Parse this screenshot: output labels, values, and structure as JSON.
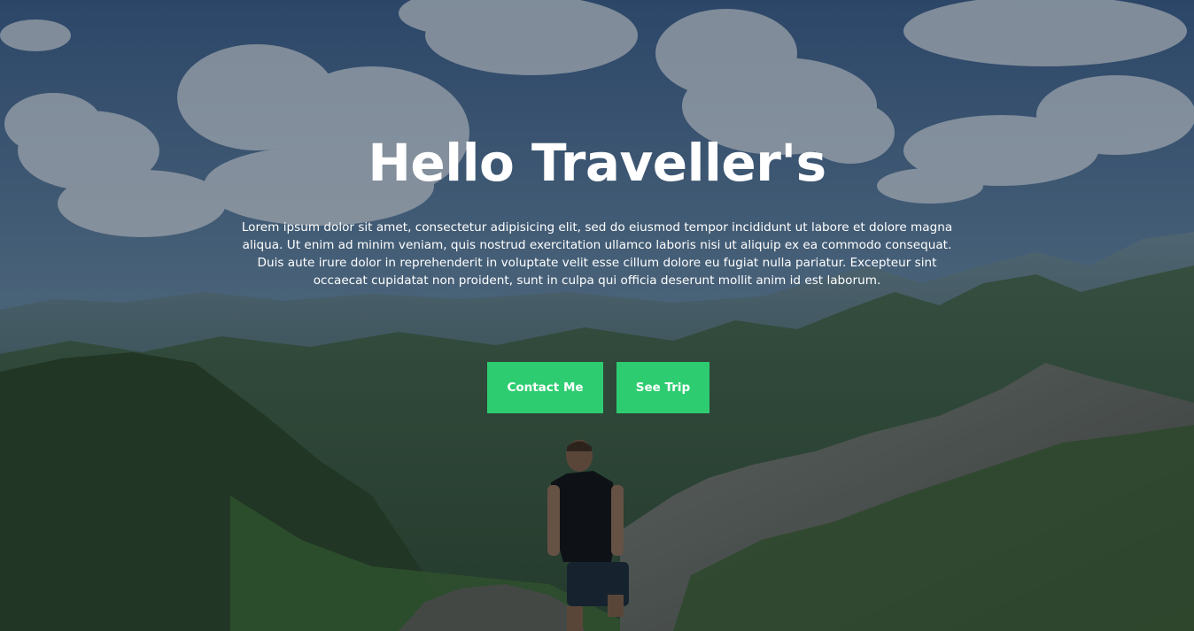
{
  "hero": {
    "title": "Hello Traveller's",
    "description": "Lorem ipsum dolor sit amet, consectetur adipisicing elit, sed do eiusmod tempor incididunt ut labore et dolore magna aliqua. Ut enim ad minim veniam, quis nostrud exercitation ullamco laboris nisi ut aliquip ex ea commodo consequat. Duis aute irure dolor in reprehenderit in voluptate velit esse cillum dolore eu fugiat nulla pariatur. Excepteur sint occaecat cupidatat non proident, sunt in culpa qui officia deserunt mollit anim id est laborum.",
    "buttons": [
      {
        "label": "Contact Me"
      },
      {
        "label": "See Trip"
      }
    ]
  },
  "colors": {
    "button": "#2ecc71",
    "text": "#ffffff"
  }
}
